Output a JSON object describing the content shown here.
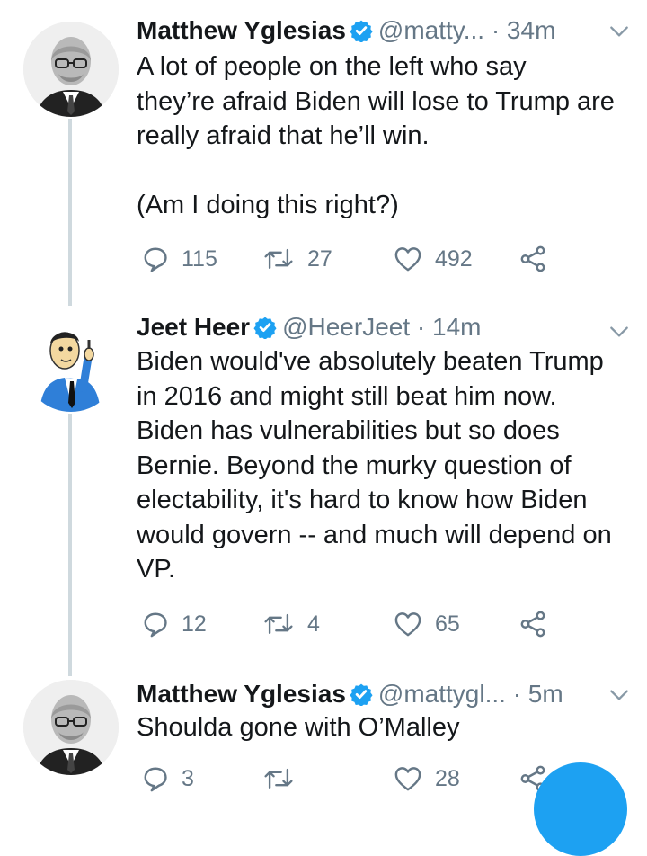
{
  "tweets": [
    {
      "author": "Matthew Yglesias",
      "handle": "@matty...",
      "time": "· 34m",
      "text": "A lot of people on the left who say\nthey’re afraid Biden will lose to Trump are\nreally afraid that he’ll win.\n\n(Am I doing this right?)",
      "replies": "115",
      "retweets": "27",
      "likes": "492"
    },
    {
      "author": "Jeet Heer",
      "handle": "@HeerJeet",
      "time": "· 14m",
      "text": "Biden would've absolutely beaten Trump\nin 2016 and might still beat him now.\nBiden has vulnerabilities but so does\nBernie. Beyond the murky question of\nelectability, it's hard to know how Biden\nwould govern -- and much will depend on\nVP.",
      "replies": "12",
      "retweets": "4",
      "likes": "65"
    },
    {
      "author": "Matthew Yglesias",
      "handle": "@mattygl...",
      "time": "· 5m",
      "text": "Shoulda gone with O’Malley",
      "replies": "3",
      "retweets": "",
      "likes": "28"
    }
  ],
  "colors": {
    "text": "#14171a",
    "secondary": "#657786",
    "verified": "#1da1f2",
    "thread_line": "#cfd9de",
    "fab": "#1da1f2"
  },
  "icons": [
    "verified-badge-icon",
    "chevron-down-icon",
    "reply-icon",
    "retweet-icon",
    "like-icon",
    "share-icon"
  ]
}
